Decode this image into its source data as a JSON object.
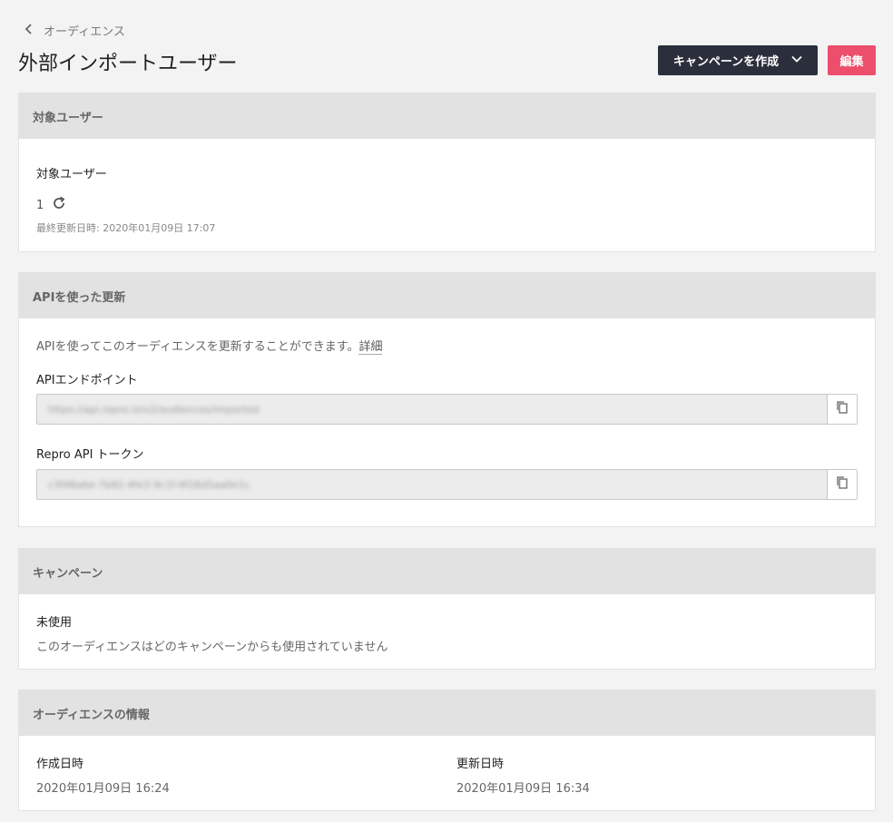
{
  "breadcrumb": {
    "back_label": "オーディエンス"
  },
  "page": {
    "title": "外部インポートユーザー"
  },
  "actions": {
    "create_campaign_label": "キャンペーンを作成",
    "edit_label": "編集"
  },
  "target_users": {
    "header": "対象ユーザー",
    "label": "対象ユーザー",
    "count": "1",
    "last_updated": "最終更新日時: 2020年01月09日 17:07"
  },
  "api": {
    "header": "APIを使った更新",
    "description": "APIを使ってこのオーディエンスを更新することができます。",
    "detail_link": "詳細",
    "endpoint_label": "APIエンドポイント",
    "endpoint_value": "https://api.repro.io/v2/audiences/imported",
    "token_label": "Repro API トークン",
    "token_value": "c3f48a6e-7b82-4fe3-9c1f-4f28d5aa0e1c"
  },
  "campaign": {
    "header": "キャンペーン",
    "status_label": "未使用",
    "status_text": "このオーディエンスはどのキャンペーンからも使用されていません"
  },
  "info": {
    "header": "オーディエンスの情報",
    "created_label": "作成日時",
    "created_value": "2020年01月09日 16:24",
    "updated_label": "更新日時",
    "updated_value": "2020年01月09日 16:34"
  },
  "colors": {
    "primary_dark": "#2b2f3b",
    "accent": "#ec4e6b",
    "section_header_bg": "#e2e2e2"
  },
  "icons": {
    "back": "chevron-left-icon",
    "dropdown": "chevron-down-icon",
    "refresh": "refresh-icon",
    "copy": "copy-icon"
  }
}
